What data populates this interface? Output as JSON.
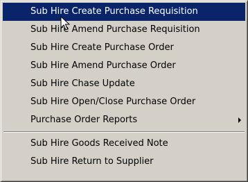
{
  "menu": {
    "items": [
      {
        "label": "Sub Hire Create Purchase Requisition",
        "highlighted": true
      },
      {
        "label": "Sub Hire Amend Purchase Requisition"
      },
      {
        "label": "Sub Hire Create Purchase Order"
      },
      {
        "label": "Sub Hire Amend Purchase Order"
      },
      {
        "label": "Sub Hire Chase Update"
      },
      {
        "label": "Sub Hire Open/Close Purchase Order"
      },
      {
        "label": "Purchase Order Reports",
        "has_submenu": true,
        "submenu_icon": "chevron-right-icon"
      }
    ],
    "items_after_separator": [
      {
        "label": "Sub Hire Goods Received Note"
      },
      {
        "label": "Sub Hire Return to Supplier"
      }
    ]
  },
  "colors": {
    "menu_background": "#d4d0c8",
    "highlight_background": "#0a246a",
    "highlight_text": "#ffffff",
    "text": "#000000"
  },
  "cursor_icon": "mouse-pointer-icon"
}
